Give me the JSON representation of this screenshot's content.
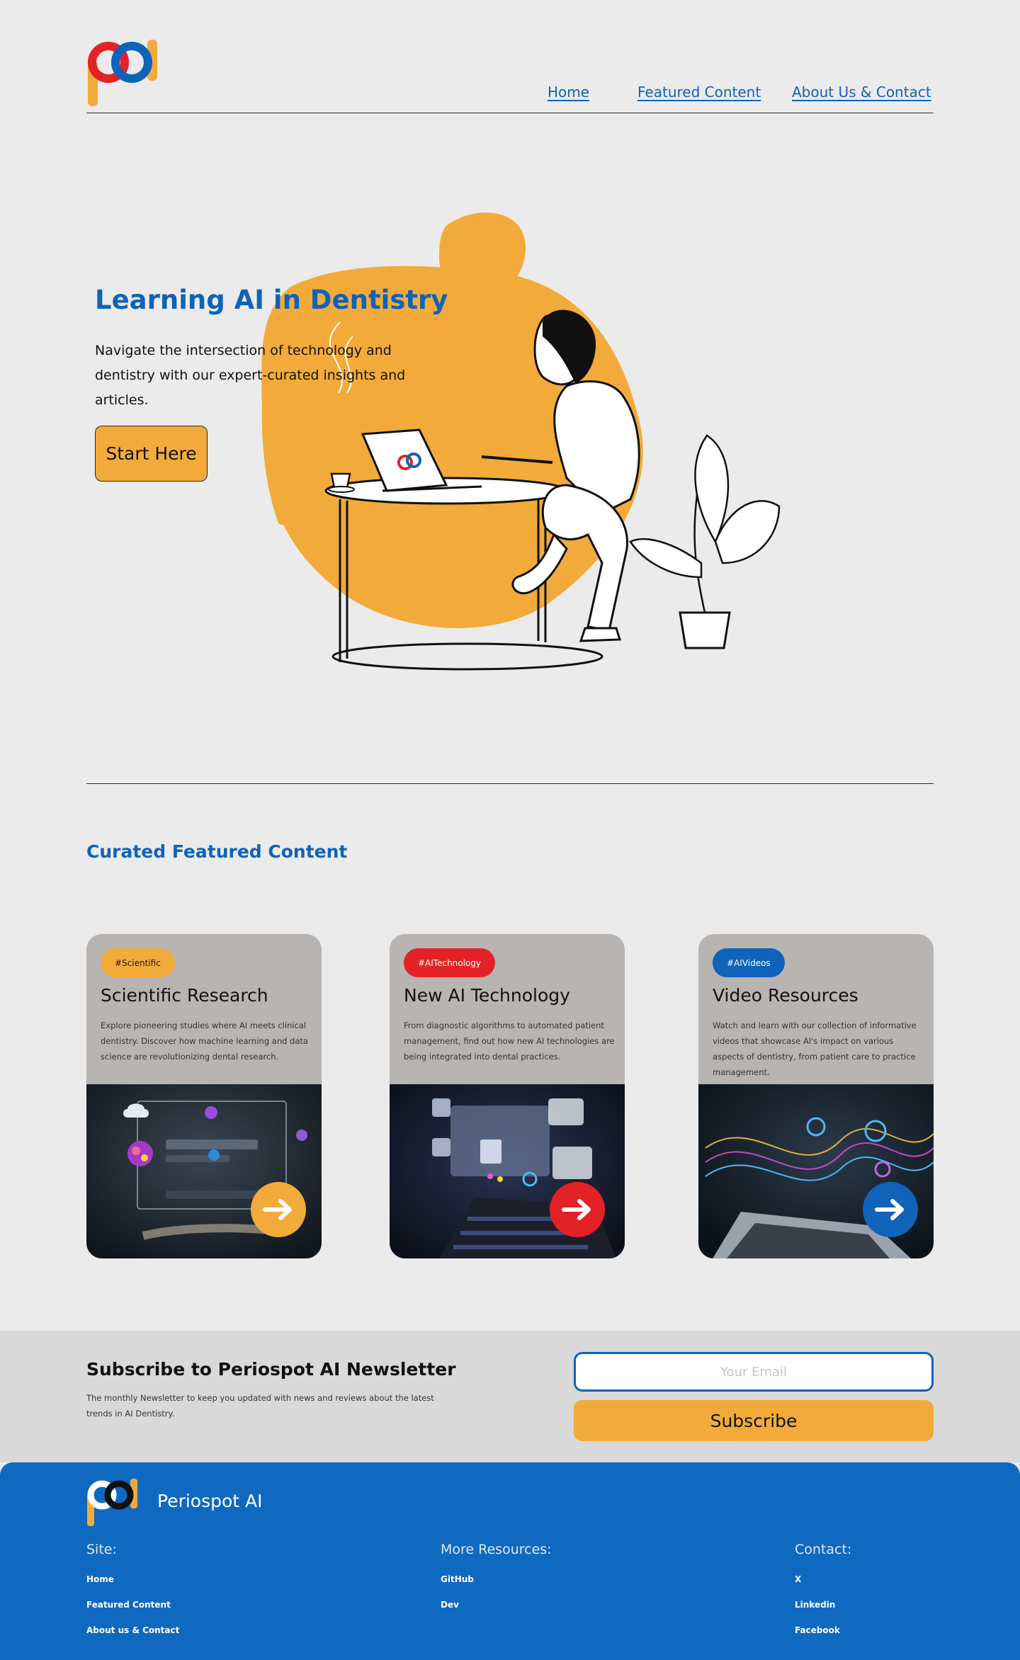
{
  "header": {
    "logo_icon": "periospot-logo-icon",
    "nav": [
      "Home",
      "Featured Content",
      "About Us & Contact"
    ]
  },
  "hero": {
    "title": "Learning AI in Dentistry",
    "text": "Navigate the intersection of technology and dentistry with our expert-curated insights and articles.",
    "cta": "Start Here"
  },
  "featured": {
    "title": "Curated Featured Content",
    "cards": [
      {
        "tag": "#Scientific",
        "title": "Scientific Research",
        "desc": "Explore pioneering studies where AI meets clinical dentistry. Discover how machine learning and data science are revolutionizing dental research.",
        "arrow_color": "#f2ab3a"
      },
      {
        "tag": "#AITechnology",
        "title": "New AI Technology",
        "desc": "From diagnostic algorithms to automated patient management, find out how new AI technologies are being integrated into dental practices.",
        "arrow_color": "#e22227"
      },
      {
        "tag": "#AIVideos",
        "title": "Video Resources",
        "desc": "Watch and learn with our collection of informative videos that showcase AI's impact on various aspects of dentistry, from patient care to practice management.",
        "arrow_color": "#0f63b8"
      }
    ]
  },
  "newsletter": {
    "title": "Subscribe to Periospot AI Newsletter",
    "text": "The monthly Newsletter to keep you updated with news and reviews about the latest trends in AI Dentistry.",
    "email_placeholder": "Your Email",
    "button": "Subscribe"
  },
  "footer": {
    "brand": "Periospot AI",
    "site_title": "Site:",
    "site_links": [
      "Home",
      "Featured Content",
      "About us & Contact"
    ],
    "resources_title": "More Resources:",
    "resources_links": [
      "GitHub",
      "Dev"
    ],
    "contact_title": "Contact:",
    "contact_links": [
      "X",
      "Linkedin",
      "Facebook"
    ]
  },
  "colors": {
    "brand_blue": "#0f63b8",
    "accent_orange": "#f2ab3a",
    "accent_red": "#e22227",
    "footer_blue": "#0f69c1"
  }
}
